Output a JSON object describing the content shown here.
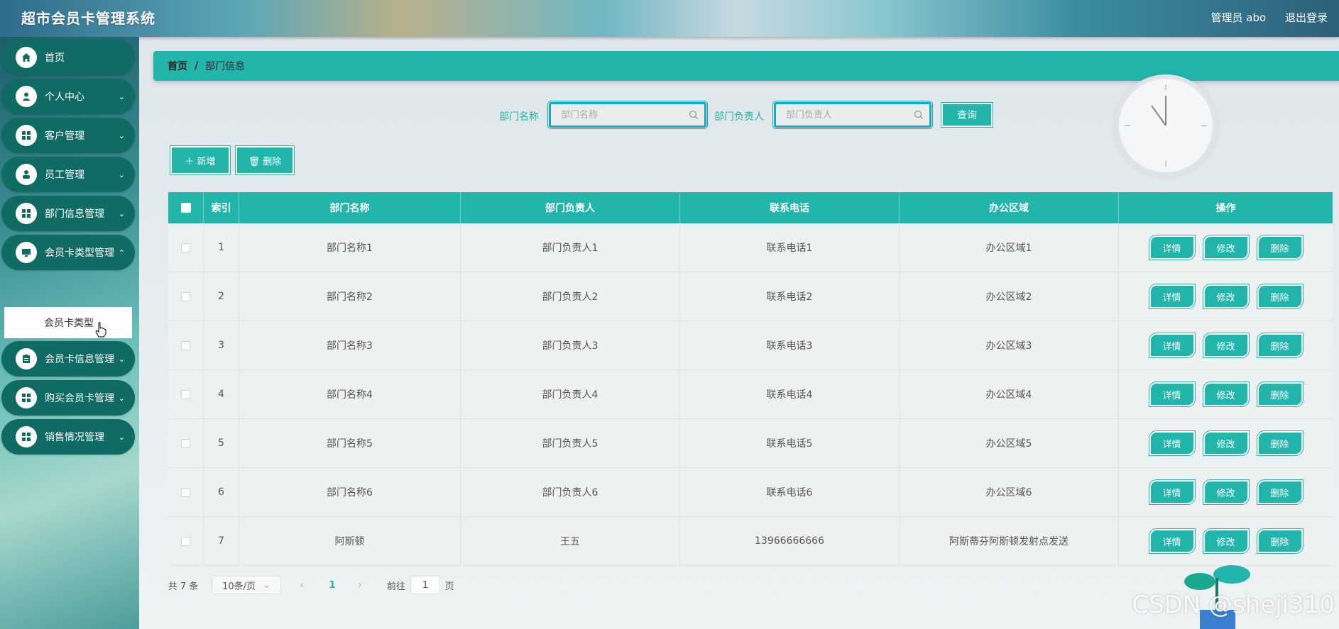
{
  "header": {
    "app_title": "超市会员卡管理系统",
    "user_label": "管理员 abo",
    "logout_label": "退出登录"
  },
  "sidebar": {
    "items": [
      {
        "label": "首页",
        "icon": "home-icon"
      },
      {
        "label": "个人中心",
        "icon": "user-icon"
      },
      {
        "label": "客户管理",
        "icon": "grid-icon"
      },
      {
        "label": "员工管理",
        "icon": "person-icon"
      },
      {
        "label": "部门信息管理",
        "icon": "grid-icon"
      },
      {
        "label": "会员卡类型管理",
        "icon": "monitor-icon"
      },
      {
        "label": "会员卡信息管理",
        "icon": "clipboard-icon"
      },
      {
        "label": "购买会员卡管理",
        "icon": "grid-icon"
      },
      {
        "label": "销售情况管理",
        "icon": "grid-icon"
      }
    ],
    "submenu_item": "会员卡类型"
  },
  "breadcrumb": {
    "home": "首页",
    "sep": "/",
    "current": "部门信息"
  },
  "search": {
    "field1_label": "部门名称",
    "field1_placeholder": "部门名称",
    "field2_label": "部门负责人",
    "field2_placeholder": "部门负责人",
    "query_button": "查询"
  },
  "actions": {
    "add": "＋ 新增",
    "delete": "🗑 删除"
  },
  "table": {
    "columns": [
      "",
      "索引",
      "部门名称",
      "部门负责人",
      "联系电话",
      "办公区域",
      "操作"
    ],
    "rows": [
      {
        "index": "1",
        "name": "部门名称1",
        "leader": "部门负责人1",
        "phone": "联系电话1",
        "area": "办公区域1"
      },
      {
        "index": "2",
        "name": "部门名称2",
        "leader": "部门负责人2",
        "phone": "联系电话2",
        "area": "办公区域2"
      },
      {
        "index": "3",
        "name": "部门名称3",
        "leader": "部门负责人3",
        "phone": "联系电话3",
        "area": "办公区域3"
      },
      {
        "index": "4",
        "name": "部门名称4",
        "leader": "部门负责人4",
        "phone": "联系电话4",
        "area": "办公区域4"
      },
      {
        "index": "5",
        "name": "部门名称5",
        "leader": "部门负责人5",
        "phone": "联系电话5",
        "area": "办公区域5"
      },
      {
        "index": "6",
        "name": "部门名称6",
        "leader": "部门负责人6",
        "phone": "联系电话6",
        "area": "办公区域6"
      },
      {
        "index": "7",
        "name": "阿斯顿",
        "leader": "王五",
        "phone": "13966666666",
        "area": "阿斯蒂芬阿斯顿发射点发送"
      }
    ],
    "row_buttons": {
      "detail": "详情",
      "edit": "修改",
      "delete": "删除"
    }
  },
  "pagination": {
    "total": "共 7 条",
    "page_size": "10条/页",
    "current_page": "1",
    "goto_label": "前往",
    "goto_value": "1",
    "page_suffix": "页"
  },
  "watermark": "CSDN @sheji310",
  "colors": {
    "accent": "#22b5ab",
    "sidebar_item": "#0f6b63",
    "focus_border": "#1aa7c0"
  }
}
